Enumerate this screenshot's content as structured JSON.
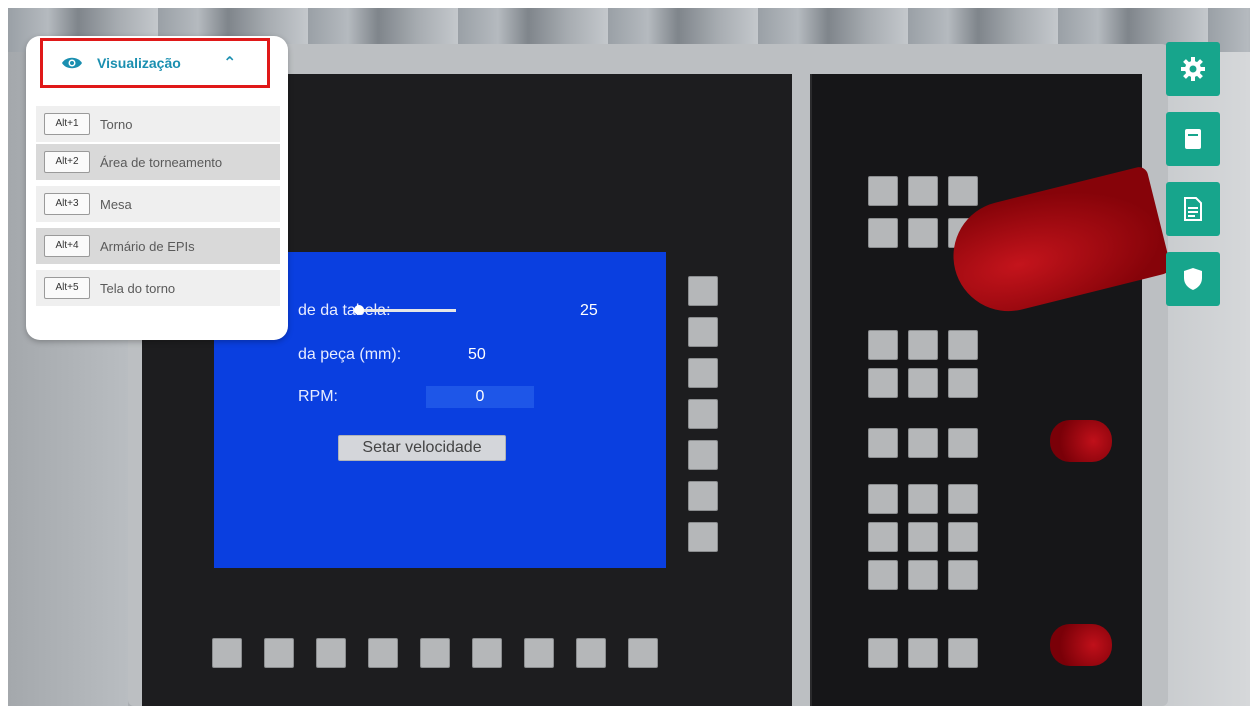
{
  "menu": {
    "toggle_label": "Visualização",
    "items": [
      {
        "shortcut": "Alt+1",
        "label": "Torno"
      },
      {
        "shortcut": "Alt+2",
        "label": "Área de torneamento"
      },
      {
        "shortcut": "Alt+3",
        "label": "Mesa"
      },
      {
        "shortcut": "Alt+4",
        "label": "Armário de EPIs"
      },
      {
        "shortcut": "Alt+5",
        "label": "Tela do torno"
      }
    ]
  },
  "cnc_screen": {
    "row1_label": "de da tabela:",
    "slider_value_text": "25",
    "row2_label": "da peça (mm):",
    "row2_value": "50",
    "rpm_label": "RPM:",
    "rpm_value": "0",
    "set_speed_label": "Setar velocidade"
  },
  "side_toolbar": {
    "buttons": [
      "gear-icon",
      "document-icon",
      "report-icon",
      "shield-icon"
    ],
    "color": "#17a58c"
  },
  "colors": {
    "highlight_border": "#e01818",
    "screen_blue": "#0a3fe0",
    "menu_accent": "#1a8fb0"
  }
}
